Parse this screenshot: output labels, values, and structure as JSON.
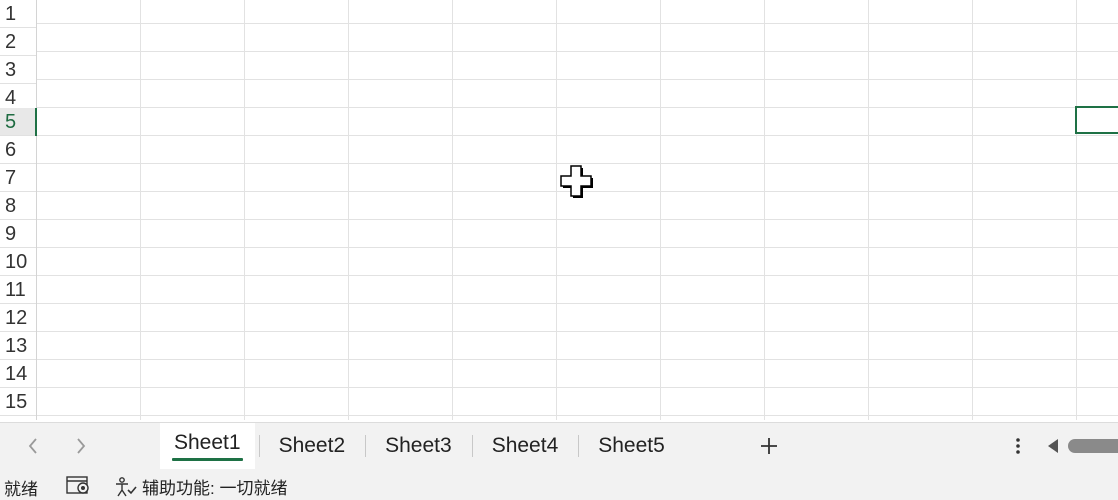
{
  "grid": {
    "rows": [
      "1",
      "2",
      "3",
      "4",
      "5",
      "6",
      "7",
      "8",
      "9",
      "10",
      "11",
      "12",
      "13",
      "14",
      "15"
    ],
    "active_row": "5"
  },
  "sheet_tabs": {
    "prev_icon": "chevron-left-icon",
    "next_icon": "chevron-right-icon",
    "tabs": [
      {
        "label": "Sheet1",
        "active": true
      },
      {
        "label": "Sheet2",
        "active": false
      },
      {
        "label": "Sheet3",
        "active": false
      },
      {
        "label": "Sheet4",
        "active": false
      },
      {
        "label": "Sheet5",
        "active": false
      }
    ],
    "add_icon": "plus-icon",
    "more_icon": "vertical-ellipsis-icon"
  },
  "status_bar": {
    "ready": "就绪",
    "macro_icon": "macro-record-icon",
    "accessibility": "辅助功能: 一切就绪",
    "accessibility_icon": "accessibility-icon"
  },
  "colors": {
    "accent": "#1e7145",
    "chrome_bg": "#f2f2f2",
    "gridline": "#e2e2e2"
  }
}
